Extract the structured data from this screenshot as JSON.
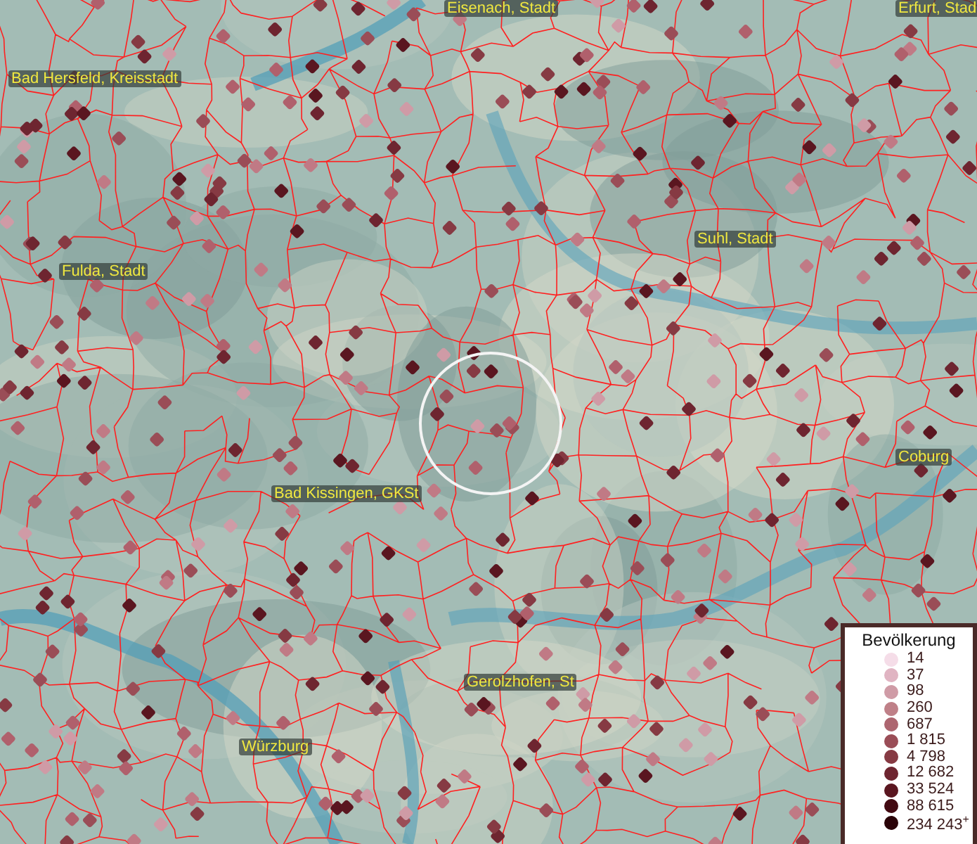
{
  "map": {
    "places": [
      {
        "name": "Eisenach, Stadt"
      },
      {
        "name": "Erfurt, Stad"
      },
      {
        "name": "Bad Hersfeld, Kreisstadt"
      },
      {
        "name": "Fulda, Stadt"
      },
      {
        "name": "Suhl, Stadt"
      },
      {
        "name": "Bad Kissingen, GKSt"
      },
      {
        "name": "Coburg"
      },
      {
        "name": "Gerolzhofen, St"
      },
      {
        "name": "Würzburg"
      }
    ]
  },
  "legend": {
    "title": "Bevölkerung",
    "items": [
      {
        "label": "14",
        "color": "#f5dde8"
      },
      {
        "label": "37",
        "color": "#e0b4c2"
      },
      {
        "label": "98",
        "color": "#cf9ba6"
      },
      {
        "label": "260",
        "color": "#bf8088"
      },
      {
        "label": "687",
        "color": "#ad6670"
      },
      {
        "label": "1 815",
        "color": "#9a4d57"
      },
      {
        "label": "4 798",
        "color": "#863a43"
      },
      {
        "label": "12 682",
        "color": "#6e2530"
      },
      {
        "label": "33 524",
        "color": "#5a1620"
      },
      {
        "label": "88 615",
        "color": "#420a12"
      },
      {
        "label": "234 243$^{+}$",
        "color": "#2a0308"
      }
    ]
  }
}
